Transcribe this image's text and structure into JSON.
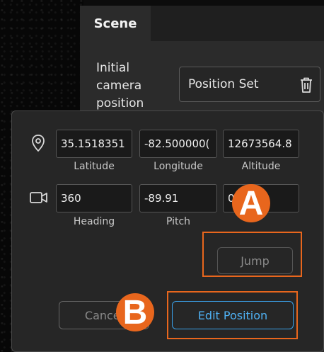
{
  "scene": {
    "tab_label": "Scene",
    "initial_camera_label": "Initial camera position",
    "position_value": "Position Set"
  },
  "camera": {
    "latitude": "35.1518351",
    "longitude": "-82.500000(",
    "altitude": "12673564.8",
    "heading": "360",
    "pitch": "-89.91",
    "roll": "0",
    "labels": {
      "latitude": "Latitude",
      "longitude": "Longitude",
      "altitude": "Altitude",
      "heading": "Heading",
      "pitch": "Pitch"
    }
  },
  "buttons": {
    "jump": "Jump",
    "cancel": "Cancel",
    "edit_position": "Edit Position"
  },
  "callouts": {
    "a": "A",
    "b": "B"
  },
  "colors": {
    "accent": "#e8661d",
    "primary_blue": "#3aa0e8"
  },
  "icons": [
    "location-pin-icon",
    "video-camera-icon",
    "trash-icon"
  ]
}
